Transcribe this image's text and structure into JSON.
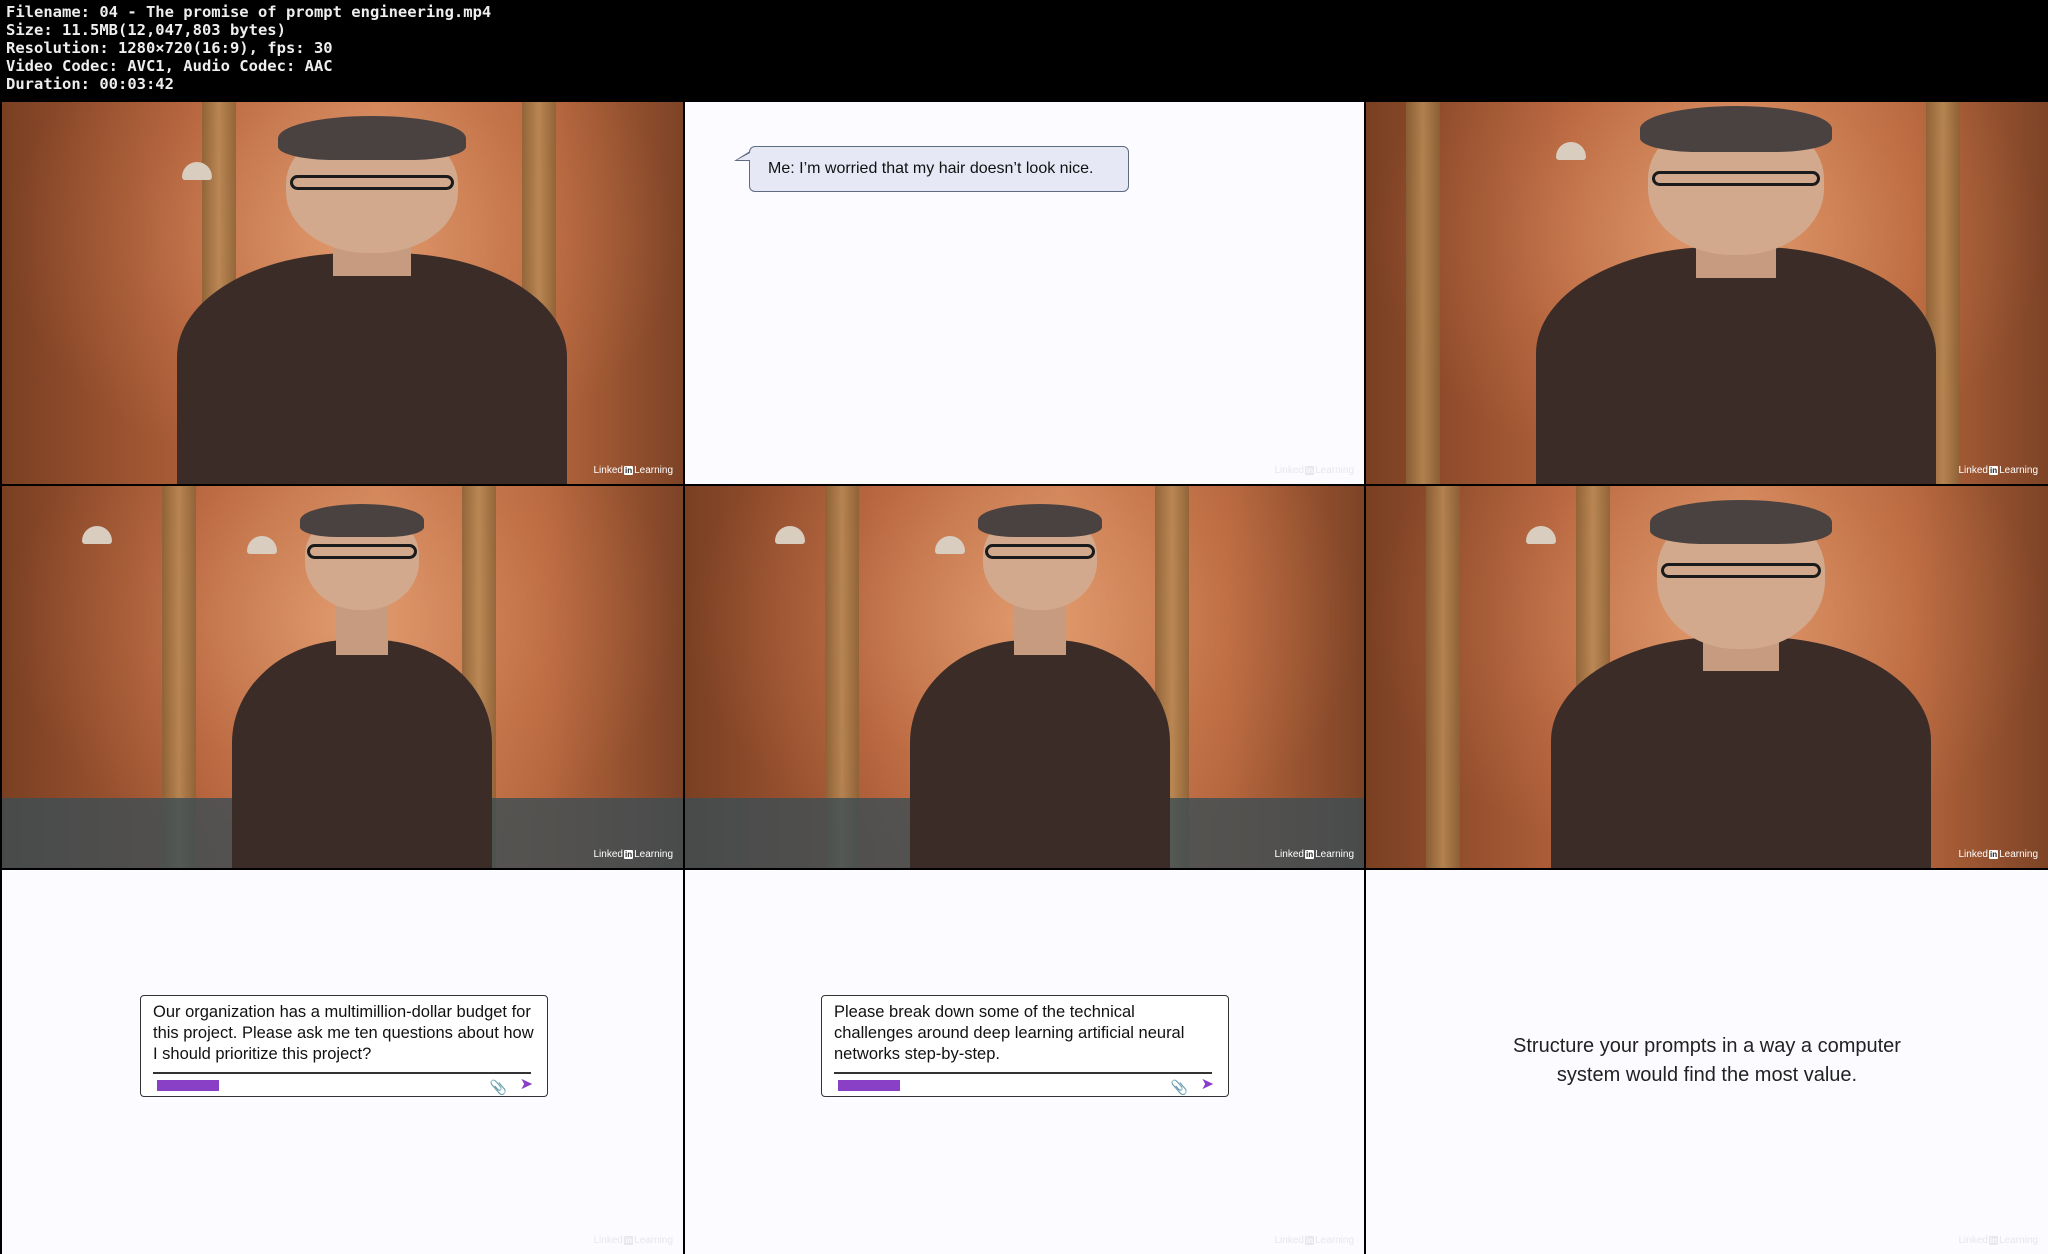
{
  "header": {
    "filename": "Filename: 04 - The promise of prompt engineering.mp4",
    "size": "Size: 11.5MB(12,047,803 bytes)",
    "resolution": "Resolution: 1280×720(16:9), fps: 30",
    "codec": "Video Codec: AVC1, Audio Codec: AAC",
    "duration": "Duration: 00:03:42"
  },
  "watermark": {
    "linked": "Linked",
    "in": "in",
    "learning": "Learning"
  },
  "slides": {
    "speech_bubble": "Me: I’m worried that my hair doesn’t look nice.",
    "prompt1": "Our organization has a multimillion-dollar budget for this project. Please ask me ten questions about how I should prioritize this project?",
    "prompt2": "Please break down some of the technical challenges around deep learning artificial neural networks step-by-step.",
    "caption": "Structure your prompts in a way a computer system would find the most value."
  },
  "icons": {
    "attach": "paperclip-icon",
    "send": "send-arrow-icon"
  },
  "colors": {
    "accent": "#8a3fc7",
    "slide_bg": "#fcfbff",
    "bubble_bg": "#e6e9f5"
  }
}
